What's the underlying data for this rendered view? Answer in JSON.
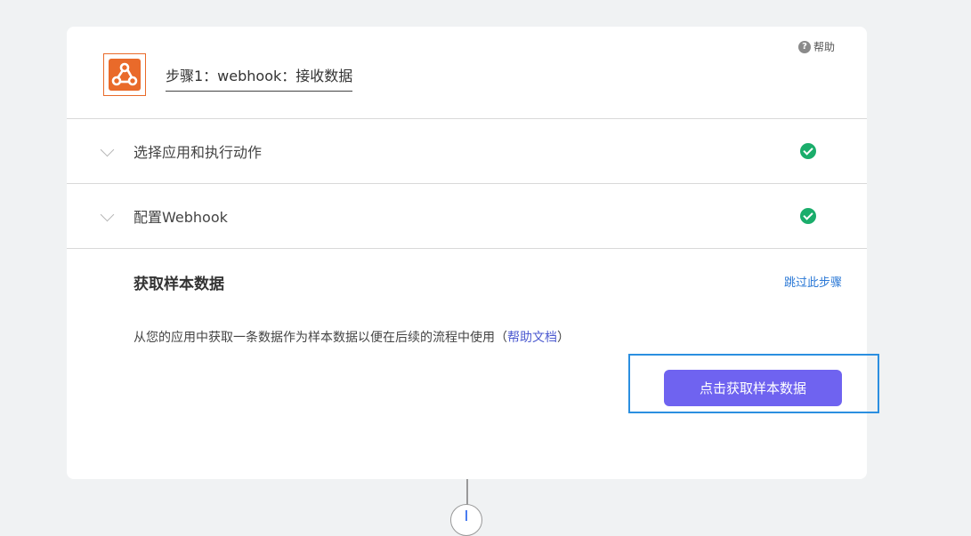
{
  "help": {
    "icon": "question-circle-icon",
    "label": "帮助"
  },
  "step": {
    "icon": "webhook-icon",
    "title": "步骤1：webhook：接收数据"
  },
  "sections": [
    {
      "label": "选择应用和执行动作",
      "status": "complete",
      "icon": "check-circle-icon"
    },
    {
      "label": "配置Webhook",
      "status": "complete",
      "icon": "check-circle-icon"
    }
  ],
  "sample": {
    "title": "获取样本数据",
    "skip_label": "跳过此步骤",
    "description": "从您的应用中获取一条数据作为样本数据以便在后续的流程中使用",
    "paren_open": "（",
    "help_doc_label": "帮助文档",
    "paren_close": "）",
    "button_label": "点击获取样本数据"
  },
  "colors": {
    "accent_button": "#6f63f0",
    "success": "#1aad6b",
    "link": "#2a78d6",
    "webhook_orange": "#e96a2a",
    "focus_outline": "#2b8fe0"
  }
}
